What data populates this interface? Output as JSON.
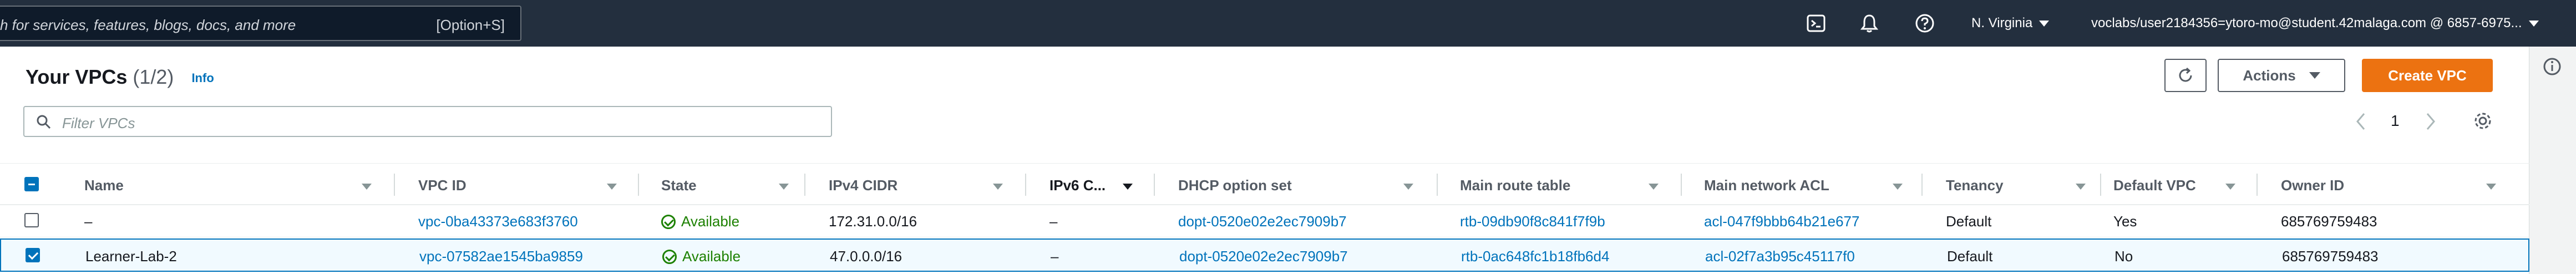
{
  "nav": {
    "search_placeholder": "h for services, features, blogs, docs, and more",
    "search_shortcut": "[Option+S]",
    "region": "N. Virginia",
    "account": "voclabs/user2184356=ytoro-mo@student.42malaga.com @ 6857-6975..."
  },
  "header": {
    "title": "Your VPCs",
    "count": "(1/2)",
    "info": "Info",
    "actions_label": "Actions",
    "create_label": "Create VPC"
  },
  "filter": {
    "placeholder": "Filter VPCs"
  },
  "pagination": {
    "page": "1"
  },
  "columns": [
    "Name",
    "VPC ID",
    "State",
    "IPv4 CIDR",
    "IPv6 C...",
    "DHCP option set",
    "Main route table",
    "Main network ACL",
    "Tenancy",
    "Default VPC",
    "Owner ID"
  ],
  "rows": [
    {
      "selected": false,
      "name": "–",
      "vpc_id": "vpc-0ba43373e683f3760",
      "state": "Available",
      "ipv4": "172.31.0.0/16",
      "ipv6": "–",
      "dhcp": "dopt-0520e02e2ec7909b7",
      "route_table": "rtb-09db90f8c841f7f9b",
      "acl": "acl-047f9bbb64b21e677",
      "tenancy": "Default",
      "default_vpc": "Yes",
      "owner": "685769759483"
    },
    {
      "selected": true,
      "name": "Learner-Lab-2",
      "vpc_id": "vpc-07582ae1545ba9859",
      "state": "Available",
      "ipv4": "47.0.0.0/16",
      "ipv6": "–",
      "dhcp": "dopt-0520e02e2ec7909b7",
      "route_table": "rtb-0ac648fc1b18fb6d4",
      "acl": "acl-02f7a3b95c45117f0",
      "tenancy": "Default",
      "default_vpc": "No",
      "owner": "685769759483"
    }
  ],
  "colors": {
    "nav_bg": "#232f3e",
    "link": "#0073bb",
    "available": "#1d8102",
    "primary_button": "#ec7211"
  }
}
